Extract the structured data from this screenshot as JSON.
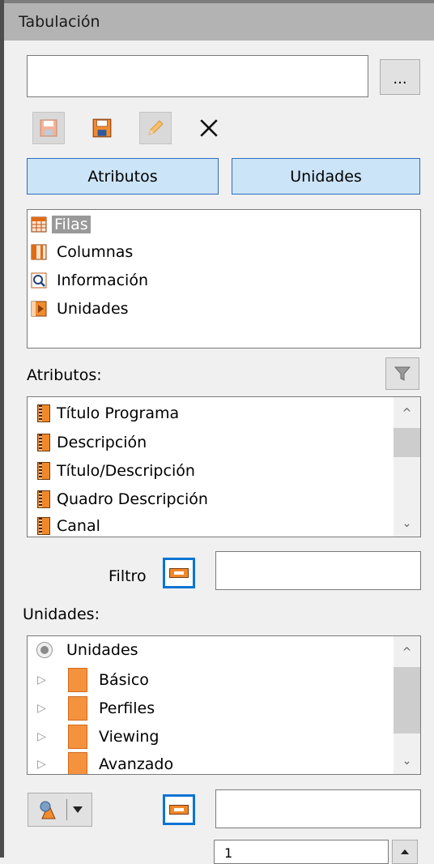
{
  "panel": {
    "title": "Tabulación"
  },
  "name_field": {
    "value": "",
    "browse_label": "..."
  },
  "toolbar": {
    "save": "save-icon",
    "save_as": "save-as-icon",
    "edit": "edit-icon",
    "delete": "delete-icon"
  },
  "tabs": {
    "atributos": "Atributos",
    "unidades": "Unidades"
  },
  "layout_items": [
    {
      "label": "Filas",
      "icon": "rows-icon",
      "selected": true
    },
    {
      "label": "Columnas",
      "icon": "columns-icon",
      "selected": false
    },
    {
      "label": "Información",
      "icon": "info-icon",
      "selected": false
    },
    {
      "label": "Unidades",
      "icon": "units-icon",
      "selected": false
    }
  ],
  "atributos_section": {
    "label": "Atributos:",
    "items": [
      "Título Programa",
      "Descripción",
      "Título/Descripción",
      "Quadro Descripción",
      "Canal"
    ],
    "filter_label": "Filtro",
    "filter_value": ""
  },
  "unidades_section": {
    "label": "Unidades:",
    "root": "Unidades",
    "folders": [
      "Básico",
      "Perfiles",
      "Viewing",
      "Avanzado"
    ],
    "filter_value": ""
  },
  "bottom": {
    "spinner_value": "1"
  }
}
